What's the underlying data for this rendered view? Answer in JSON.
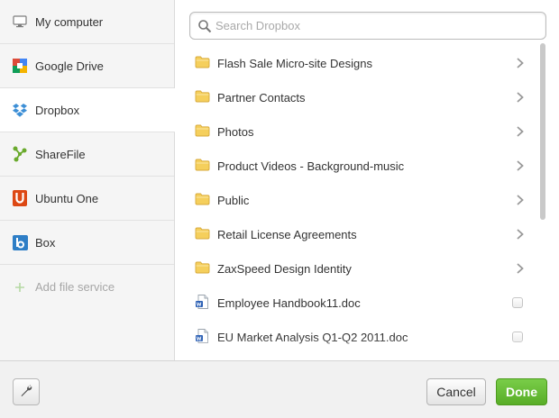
{
  "sidebar": {
    "items": [
      {
        "label": "My computer",
        "icon": "monitor-icon"
      },
      {
        "label": "Google Drive",
        "icon": "google-drive-icon"
      },
      {
        "label": "Dropbox",
        "icon": "dropbox-icon",
        "active": true
      },
      {
        "label": "ShareFile",
        "icon": "sharefile-icon"
      },
      {
        "label": "Ubuntu One",
        "icon": "ubuntu-one-icon"
      },
      {
        "label": "Box",
        "icon": "box-icon"
      }
    ],
    "add_service": {
      "label": "Add file service",
      "icon": "plus-icon"
    }
  },
  "search": {
    "placeholder": "Search Dropbox",
    "value": ""
  },
  "files": [
    {
      "name": "Flash Sale Micro-site Designs",
      "kind": "folder"
    },
    {
      "name": "Partner Contacts",
      "kind": "folder"
    },
    {
      "name": "Photos",
      "kind": "folder"
    },
    {
      "name": "Product Videos - Background-music",
      "kind": "folder"
    },
    {
      "name": "Public",
      "kind": "folder"
    },
    {
      "name": "Retail License Agreements",
      "kind": "folder"
    },
    {
      "name": "ZaxSpeed Design Identity",
      "kind": "folder"
    },
    {
      "name": "Employee Handbook11.doc",
      "kind": "doc"
    },
    {
      "name": "EU Market Analysis Q1-Q2 2011.doc",
      "kind": "doc"
    }
  ],
  "footer": {
    "settings_icon": "wrench-icon",
    "cancel_label": "Cancel",
    "done_label": "Done"
  },
  "colors": {
    "done_green": "#5db32c",
    "folder_yellow": "#f5cf5c",
    "dropbox_blue": "#3d8fd6",
    "sharefile_green": "#6aaa2d",
    "ubuntu_orange": "#dd4814",
    "box_blue": "#2e7ec6"
  }
}
